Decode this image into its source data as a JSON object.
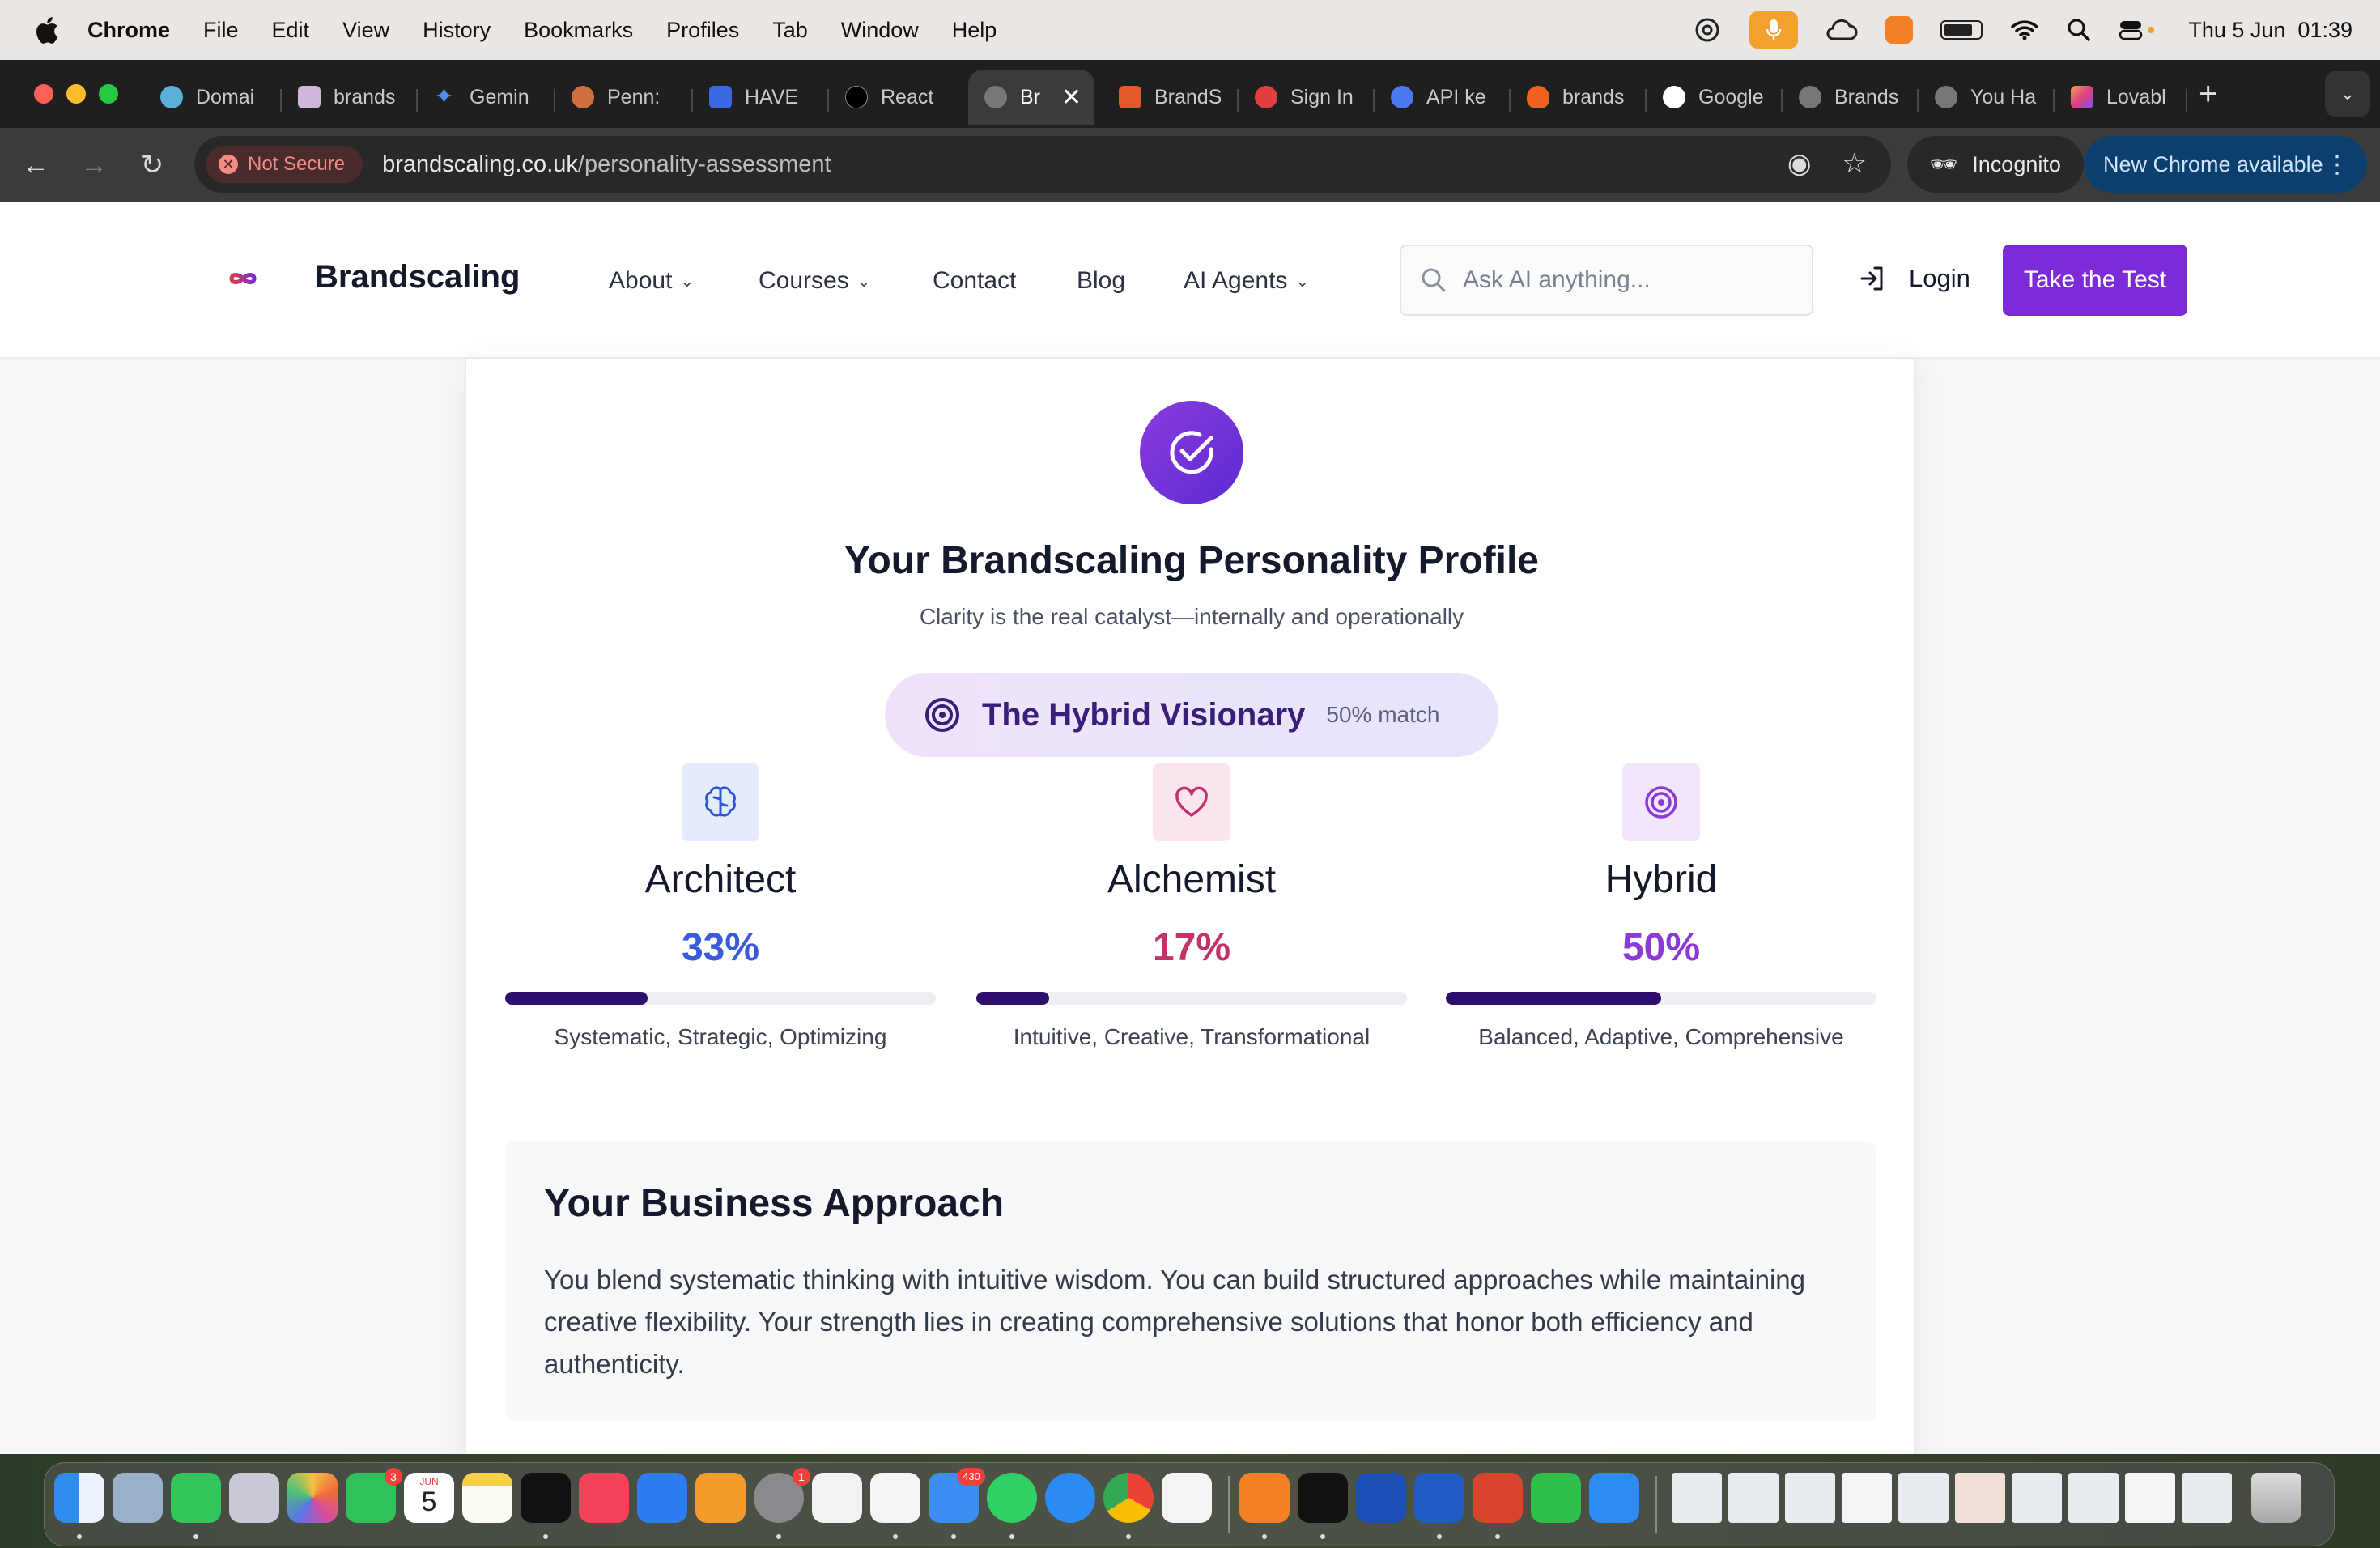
{
  "menubar": {
    "app": "Chrome",
    "items": [
      "File",
      "Edit",
      "View",
      "History",
      "Bookmarks",
      "Profiles",
      "Tab",
      "Window",
      "Help"
    ],
    "datetime": "Thu 5 Jun  01:39"
  },
  "tabs": [
    {
      "label": "Domai",
      "color": "#5ab0d8"
    },
    {
      "label": "brands",
      "color": "#d0b6d8"
    },
    {
      "label": "Gemin",
      "color": "#4f8df5"
    },
    {
      "label": "Penn:",
      "color": "#d07040"
    },
    {
      "label": "HAVE",
      "color": "#3a68e0"
    },
    {
      "label": "React",
      "color": "#222222"
    },
    {
      "label": "Br",
      "color": "#777777",
      "active": true
    },
    {
      "label": "BrandS",
      "color": "#e05a2a"
    },
    {
      "label": "Sign In",
      "color": "#e04040"
    },
    {
      "label": "API ke",
      "color": "#4a78f0"
    },
    {
      "label": "brands",
      "color": "#f06020"
    },
    {
      "label": "Google",
      "color": "#ffffff"
    },
    {
      "label": "Brands",
      "color": "#777777"
    },
    {
      "label": "You Ha",
      "color": "#777777"
    },
    {
      "label": "Lovabl",
      "color": "#e05080"
    }
  ],
  "addressbar": {
    "security": "Not Secure",
    "domain": "brandscaling.co.uk",
    "path": "/personality-assessment",
    "incognito": "Incognito",
    "update": "New Chrome available"
  },
  "site": {
    "brand": "Brandscaling",
    "nav": {
      "about": "About",
      "courses": "Courses",
      "contact": "Contact",
      "blog": "Blog",
      "agents": "AI Agents"
    },
    "search_placeholder": "Ask AI anything...",
    "login": "Login",
    "cta": "Take the Test"
  },
  "result": {
    "title": "Your Brandscaling Personality Profile",
    "subtitle": "Clarity is the real catalyst—internally and operationally",
    "profile_name": "The Hybrid Visionary",
    "profile_match": "50% match",
    "types": [
      {
        "name": "Architect",
        "percent": "33%",
        "value": 33,
        "traits": "Systematic, Strategic, Optimizing",
        "color": "#3a5bd9",
        "icon": "brain-icon"
      },
      {
        "name": "Alchemist",
        "percent": "17%",
        "value": 17,
        "traits": "Intuitive, Creative, Transformational",
        "color": "#c2336a",
        "icon": "heart-icon"
      },
      {
        "name": "Hybrid",
        "percent": "50%",
        "value": 50,
        "traits": "Balanced, Adaptive, Comprehensive",
        "color": "#8b3ad8",
        "icon": "target-icon"
      }
    ],
    "approach_title": "Your Business Approach",
    "approach_text": "You blend systematic thinking with intuitive wisdom. You can build structured approaches while maintaining creative flexibility. Your strength lies in creating comprehensive solutions that honor both efficiency and authenticity."
  },
  "dock": {
    "badges": {
      "facetime": "3",
      "calendar_month": "JUN",
      "calendar_day": "5",
      "settings": "1",
      "mail": "430"
    }
  }
}
